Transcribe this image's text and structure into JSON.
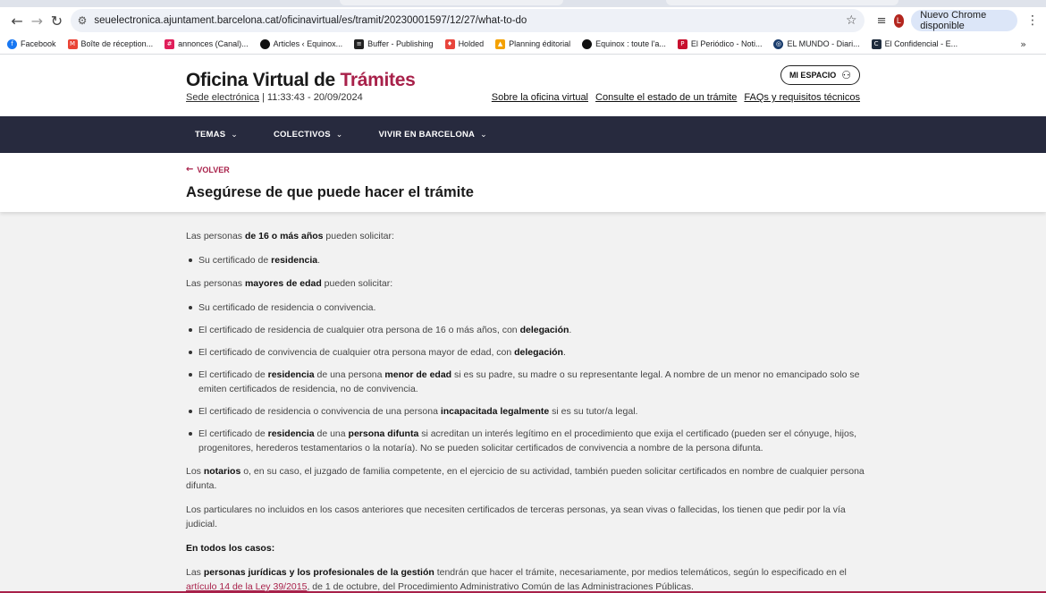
{
  "browser": {
    "url": "seuelectronica.ajuntament.barcelona.cat/oficinavirtual/es/tramit/20230001597/12/27/what-to-do",
    "profile_initial": "L",
    "update_label": "Nuevo Chrome disponible",
    "bookmarks": [
      {
        "label": "Facebook",
        "color": "#1877f2"
      },
      {
        "label": "Boîte de réception...",
        "color": "#ea4335"
      },
      {
        "label": "annonces (Canal)...",
        "color": "#e01e5a"
      },
      {
        "label": "Articles ‹ Equinox...",
        "color": "#111111"
      },
      {
        "label": "Buffer - Publishing",
        "color": "#222222"
      },
      {
        "label": "Holded",
        "color": "#e8453c"
      },
      {
        "label": "Planning éditorial",
        "color": "#f4a100"
      },
      {
        "label": "Equinox : toute l'a...",
        "color": "#111111"
      },
      {
        "label": "El Periódico - Noti...",
        "color": "#c8102e"
      },
      {
        "label": "EL MUNDO - Diari...",
        "color": "#1a3d6d"
      },
      {
        "label": "El Confidencial - E...",
        "color": "#1f2c3d"
      }
    ]
  },
  "site": {
    "brand_main": "Oficina Virtual de ",
    "brand_accent": "Trámites",
    "sede_link": "Sede electrónica",
    "sede_time": " | 11:33:43 - 20/09/2024",
    "mi_espacio": "MI ESPACIO",
    "links": [
      "Sobre la oficina virtual",
      "Consulte el estado de un trámite",
      "FAQs y requisitos técnicos"
    ],
    "nav": [
      "TEMAS",
      "COLECTIVOS",
      "VIVIR EN BARCELONA"
    ],
    "accent_color": "#a8214a",
    "nav_color": "#272a3e"
  },
  "page": {
    "back_label": "VOLVER",
    "title": "Asegúrese de que puede hacer el trámite"
  },
  "content": {
    "p1": [
      "Las personas ",
      "de 16 o más años",
      " pueden solicitar:"
    ],
    "l1": [
      "Su certificado de ",
      "residencia",
      "."
    ],
    "p2": [
      "Las personas ",
      "mayores de edad",
      " pueden solicitar:"
    ],
    "l2": "Su certificado de residencia o convivencia.",
    "l3": [
      "El certificado de residencia de cualquier otra persona de 16 o más años, con ",
      "delegación",
      "."
    ],
    "l4": [
      "El certificado de convivencia de cualquier otra persona mayor de edad, con ",
      "delegación",
      "."
    ],
    "l5": [
      "El certificado de ",
      "residencia",
      " de una persona ",
      "menor de edad",
      " si es su padre, su madre o su representante legal. A nombre de un menor no emancipado solo se emiten certificados de residencia, no de convivencia."
    ],
    "l6": [
      "El certificado de residencia o convivencia de una persona ",
      "incapacitada legalmente",
      " si es su tutor/a legal."
    ],
    "l7": [
      "El certificado de ",
      "residencia",
      " de una ",
      "persona difunta",
      " si acreditan un interés legítimo en el procedimiento que exija el certificado (pueden ser el cónyuge, hijos, progenitores, herederos testamentarios o la notaría). No se pueden solicitar certificados de convivencia a nombre de la persona difunta."
    ],
    "p3": [
      "Los ",
      "notarios",
      " o, en su caso, el juzgado de familia competente, en el ejercicio de su actividad, también pueden solicitar certificados en nombre de cualquier persona difunta."
    ],
    "p4": "Los particulares no incluidos en los casos anteriores que necesiten certificados de terceras personas, ya sean vivas o fallecidas, los tienen que pedir por la vía judicial.",
    "p5": "En todos los casos:",
    "p6": [
      "Las ",
      "personas jurídicas y los profesionales de la gestión",
      " tendrán que hacer el trámite, necesariamente, por medios telemáticos, según lo especificado en el",
      " artículo 14 de la Ley 39/2015",
      ", de 1 de octubre, del Procedimiento Administrativo Común de las Administraciones Públicas."
    ]
  }
}
